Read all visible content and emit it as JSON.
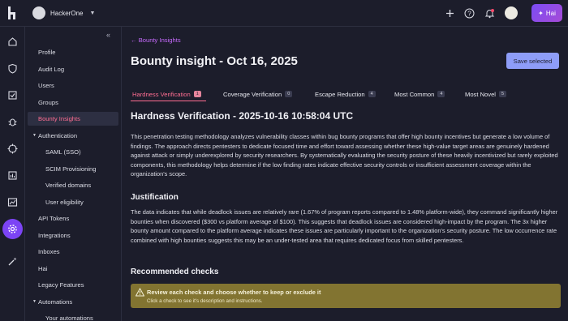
{
  "topbar": {
    "org_name": "HackerOne",
    "hai_label": "Hai",
    "icons": [
      "hackerone-logo-icon",
      "plus-icon",
      "help-icon",
      "bell-icon",
      "chevron-down-icon"
    ]
  },
  "rail": {
    "icons": [
      "home-icon",
      "shield-icon",
      "inbox-check-icon",
      "bug-icon",
      "target-icon",
      "report-icon",
      "chart-icon",
      "settings-icon",
      "magic-wand-icon"
    ],
    "active": "settings-icon"
  },
  "sidebar": {
    "collapse_label": "«",
    "items": [
      {
        "label": "Profile"
      },
      {
        "label": "Audit Log"
      },
      {
        "label": "Users"
      },
      {
        "label": "Groups"
      },
      {
        "label": "Bounty Insights"
      },
      {
        "label": "Authentication"
      },
      {
        "label": "SAML (SSO)"
      },
      {
        "label": "SCIM Provisioning"
      },
      {
        "label": "Verified domains"
      },
      {
        "label": "User eligibility"
      },
      {
        "label": "API Tokens"
      },
      {
        "label": "Integrations"
      },
      {
        "label": "Inboxes"
      },
      {
        "label": "Hai"
      },
      {
        "label": "Legacy Features"
      },
      {
        "label": "Automations"
      },
      {
        "label": "Your automations"
      }
    ]
  },
  "main": {
    "back_label": "← Bounty Insights",
    "title": "Bounty insight - Oct 16, 2025",
    "save_label": "Save selected",
    "tabs": [
      {
        "label": "Hardness Verification",
        "count": "1"
      },
      {
        "label": "Coverage Verification",
        "count": "0"
      },
      {
        "label": "Escape Reduction",
        "count": "4"
      },
      {
        "label": "Most Common",
        "count": "4"
      },
      {
        "label": "Most Novel",
        "count": "5"
      }
    ],
    "section_title": "Hardness Verification - 2025-10-16 10:58:04 UTC",
    "description": "This penetration testing methodology analyzes vulnerability classes within bug bounty programs that offer high bounty incentives but generate a low volume of findings. The approach directs pentesters to dedicate focused time and effort toward assessing whether these high-value target areas are genuinely hardened against attack or simply underexplored by security researchers. By systematically evaluating the security posture of these heavily incentivized but rarely exploited components, this methodology helps determine if the low finding rates indicate effective security controls or insufficient assessment coverage within the organization's scope.",
    "justification_title": "Justification",
    "justification": "The data indicates that while deadlock issues are relatively rare (1.67% of program reports compared to 1.48% platform-wide), they command significantly higher bounties when discovered ($300 vs platform average of $100). This suggests that deadlock issues are considered high-impact by the program. The 3x higher bounty amount compared to the platform average indicates these issues are particularly important to the organization's security posture. The low occurrence rate combined with high bounties suggests this may be an under-tested area that requires dedicated focus from skilled pentesters.",
    "recommended_title": "Recommended checks",
    "notice_title": "Review each check and choose whether to keep or exclude it",
    "notice_sub": "Click a check to see it's description and instructions."
  }
}
